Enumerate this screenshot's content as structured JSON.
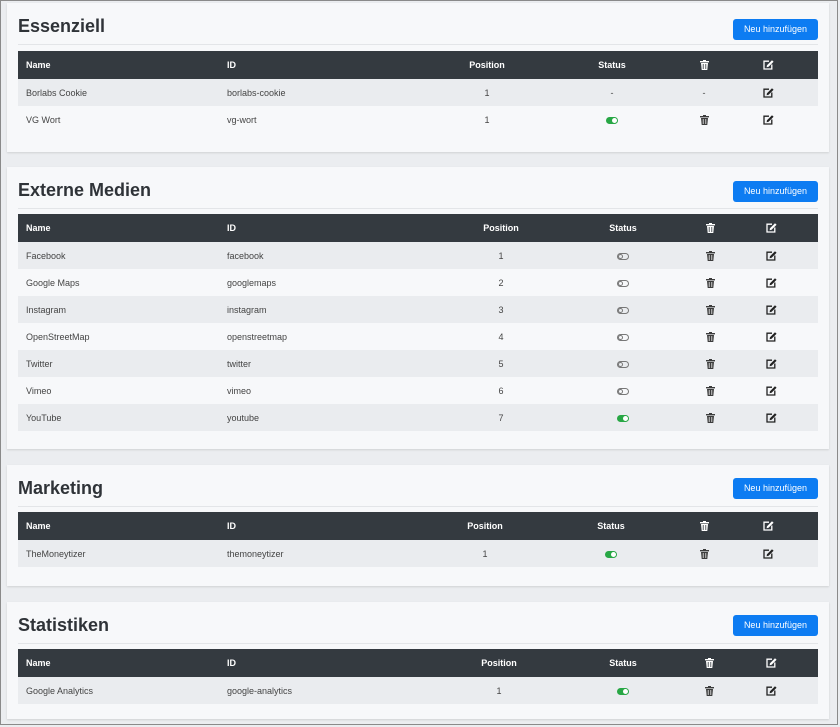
{
  "headers": {
    "name": "Name",
    "id": "ID",
    "position": "Position",
    "status": "Status"
  },
  "sections": [
    {
      "title": "Essenziell",
      "add_label": "Neu hinzufügen",
      "rows": [
        {
          "name": "Borlabs Cookie",
          "id": "borlabs-cookie",
          "position": "1",
          "status": "-",
          "delete": "-"
        },
        {
          "name": "VG Wort",
          "id": "vg-wort",
          "position": "1",
          "status": "on"
        }
      ]
    },
    {
      "title": "Externe Medien",
      "add_label": "Neu hinzufügen",
      "rows": [
        {
          "name": "Facebook",
          "id": "facebook",
          "position": "1",
          "status": "off"
        },
        {
          "name": "Google Maps",
          "id": "googlemaps",
          "position": "2",
          "status": "off"
        },
        {
          "name": "Instagram",
          "id": "instagram",
          "position": "3",
          "status": "off"
        },
        {
          "name": "OpenStreetMap",
          "id": "openstreetmap",
          "position": "4",
          "status": "off"
        },
        {
          "name": "Twitter",
          "id": "twitter",
          "position": "5",
          "status": "off"
        },
        {
          "name": "Vimeo",
          "id": "vimeo",
          "position": "6",
          "status": "off"
        },
        {
          "name": "YouTube",
          "id": "youtube",
          "position": "7",
          "status": "on"
        }
      ]
    },
    {
      "title": "Marketing",
      "add_label": "Neu hinzufügen",
      "rows": [
        {
          "name": "TheMoneytizer",
          "id": "themoneytizer",
          "position": "1",
          "status": "on"
        }
      ]
    },
    {
      "title": "Statistiken",
      "add_label": "Neu hinzufügen",
      "rows": [
        {
          "name": "Google Analytics",
          "id": "google-analytics",
          "position": "1",
          "status": "on"
        }
      ]
    }
  ],
  "icons": {
    "delete": "trash-icon",
    "edit": "edit-icon",
    "status_on": "toggle-on-icon",
    "status_off": "toggle-off-icon"
  },
  "colors": {
    "accent": "#0d7cf2",
    "header_bg": "#343a40",
    "toggle_on": "#28a745"
  }
}
